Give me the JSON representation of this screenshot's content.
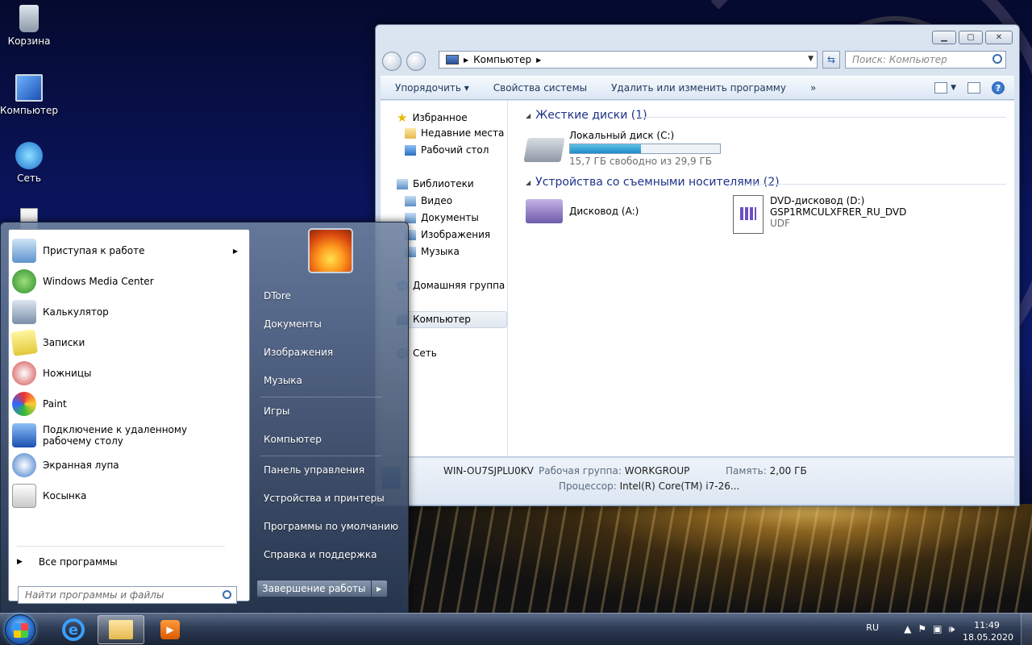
{
  "desktop": {
    "icons": [
      {
        "label": "Корзина",
        "icon": "recycle-bin-icon"
      },
      {
        "label": "Компьютер",
        "icon": "computer-icon"
      },
      {
        "label": "Сеть",
        "icon": "network-icon"
      }
    ]
  },
  "explorer": {
    "address": "Компьютер",
    "search_placeholder": "Поиск: Компьютер",
    "toolbar": {
      "organize": "Упорядочить",
      "system_properties": "Свойства системы",
      "uninstall": "Удалить или изменить программу",
      "more": "»"
    },
    "nav": {
      "favorites": "Избранное",
      "recent": "Недавние места",
      "desktop": "Рабочий стол",
      "libraries": "Библиотеки",
      "video": "Видео",
      "documents": "Документы",
      "pictures": "Изображения",
      "music": "Музыка",
      "homegroup": "Домашняя группа",
      "computer": "Компьютер",
      "network": "Сеть"
    },
    "groups": {
      "hard_disks": "Жесткие диски (1)",
      "removable": "Устройства со съемными носителями (2)"
    },
    "drive_c": {
      "name": "Локальный диск (C:)",
      "free": "15,7 ГБ свободно из 29,9 ГБ",
      "used_fraction": 0.475
    },
    "drive_a": {
      "name": "Дисковод (A:)"
    },
    "drive_d": {
      "name": "DVD-дисковод (D:)",
      "label": "GSP1RMCULXFRER_RU_DVD",
      "fs": "UDF"
    },
    "details": {
      "computer_name": "WIN-OU7SJPLU0KV",
      "workgroup_key": "Рабочая группа:",
      "workgroup_val": "WORKGROUP",
      "memory_key": "Память:",
      "memory_val": "2,00 ГБ",
      "cpu_key": "Процессор:",
      "cpu_val": "Intel(R) Core(TM) i7-26..."
    }
  },
  "start_menu": {
    "programs": [
      {
        "label": "Приступая к работе",
        "icon": "getting-started-icon"
      },
      {
        "label": "Windows Media Center",
        "icon": "media-center-icon"
      },
      {
        "label": "Калькулятор",
        "icon": "calculator-icon"
      },
      {
        "label": "Записки",
        "icon": "sticky-notes-icon"
      },
      {
        "label": "Ножницы",
        "icon": "snipping-tool-icon"
      },
      {
        "label": "Paint",
        "icon": "paint-icon"
      },
      {
        "label": "Подключение к удаленному рабочему столу",
        "icon": "remote-desktop-icon"
      },
      {
        "label": "Экранная лупа",
        "icon": "magnifier-icon"
      },
      {
        "label": "Косынка",
        "icon": "solitaire-icon"
      }
    ],
    "all_programs": "Все программы",
    "search_placeholder": "Найти программы и файлы",
    "right": {
      "user": "DTore",
      "documents": "Документы",
      "pictures": "Изображения",
      "music": "Музыка",
      "games": "Игры",
      "computer": "Компьютер",
      "control_panel": "Панель управления",
      "devices": "Устройства и принтеры",
      "default_programs": "Программы по умолчанию",
      "help": "Справка и поддержка"
    },
    "shutdown": "Завершение работы"
  },
  "taskbar": {
    "lang": "RU",
    "time": "11:49",
    "date": "18.05.2020"
  }
}
